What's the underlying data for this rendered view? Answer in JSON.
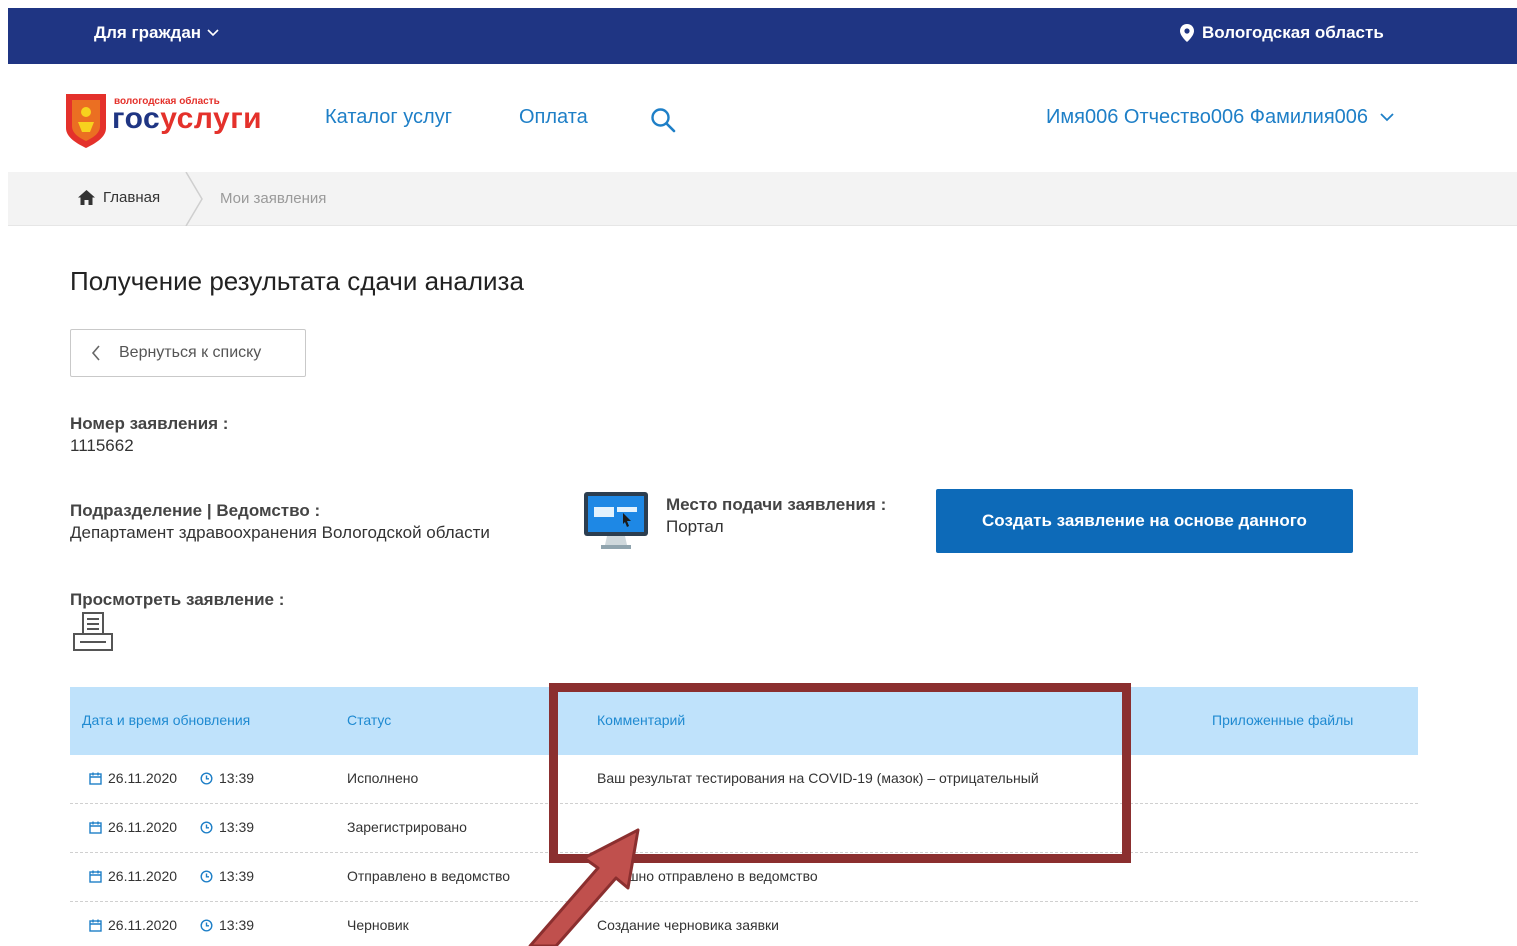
{
  "topbar": {
    "citizens_label": "Для граждан",
    "region_label": "Вологодская область"
  },
  "header": {
    "logo": {
      "region": "вологодская",
      "region_suffix": "область",
      "name_part1": "гос",
      "name_part2": "услуги"
    },
    "nav": {
      "catalog": "Каталог услуг",
      "payment": "Оплата"
    },
    "user_name": "Имя006 Отчество006 Фамилия006"
  },
  "breadcrumbs": {
    "home": "Главная",
    "current": "Мои заявления"
  },
  "page": {
    "title": "Получение результата сдачи анализа",
    "back_label": "Вернуться к списку",
    "application_number_label": "Номер заявления :",
    "application_number": "1115662",
    "department_label": "Подразделение | Ведомство :",
    "department": "Департамент здравоохранения Вологодской области",
    "submission_place_label": "Место подачи заявления :",
    "submission_place": "Портал",
    "create_button_label": "Создать заявление на основе данного",
    "view_label": "Просмотреть заявление :"
  },
  "table": {
    "headers": {
      "datetime": "Дата и время обновления",
      "status": "Статус",
      "comment": "Комментарий",
      "files": "Приложенные файлы"
    },
    "rows": [
      {
        "date": "26.11.2020",
        "time": "13:39",
        "status": "Исполнено",
        "comment": "Ваш результат тестирования на COVID-19 (мазок) – отрицательный"
      },
      {
        "date": "26.11.2020",
        "time": "13:39",
        "status": "Зарегистрировано",
        "comment": ""
      },
      {
        "date": "26.11.2020",
        "time": "13:39",
        "status": "Отправлено в ведомство",
        "comment": "Успешно отправлено в ведомство"
      },
      {
        "date": "26.11.2020",
        "time": "13:39",
        "status": "Черновик",
        "comment": "Создание черновика заявки"
      }
    ]
  },
  "colors": {
    "topbar": "#1f3583",
    "accent": "#0d6ab8",
    "link": "#1e7fc7",
    "table_header": "#bfe2fb",
    "annotation": "#8b2f2f"
  }
}
